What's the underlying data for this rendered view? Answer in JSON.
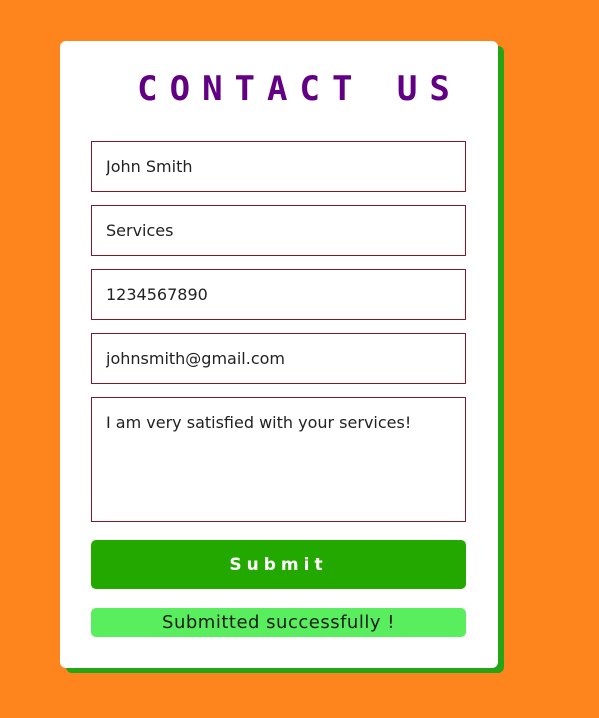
{
  "form": {
    "title": "CONTACT US",
    "name_value": "John Smith",
    "subject_value": "Services",
    "phone_value": "1234567890",
    "email_value": "johnsmith@gmail.com",
    "message_value": "I am very satisfied with your services!",
    "submit_label": "Submit",
    "status_message": "Submitted successfully !"
  },
  "colors": {
    "page_background": "#fe851e",
    "card_shadow": "#25a416",
    "title": "#620083",
    "field_border": "#7b1a2e",
    "submit_button": "#23a800",
    "status_background": "#58ee5e"
  }
}
